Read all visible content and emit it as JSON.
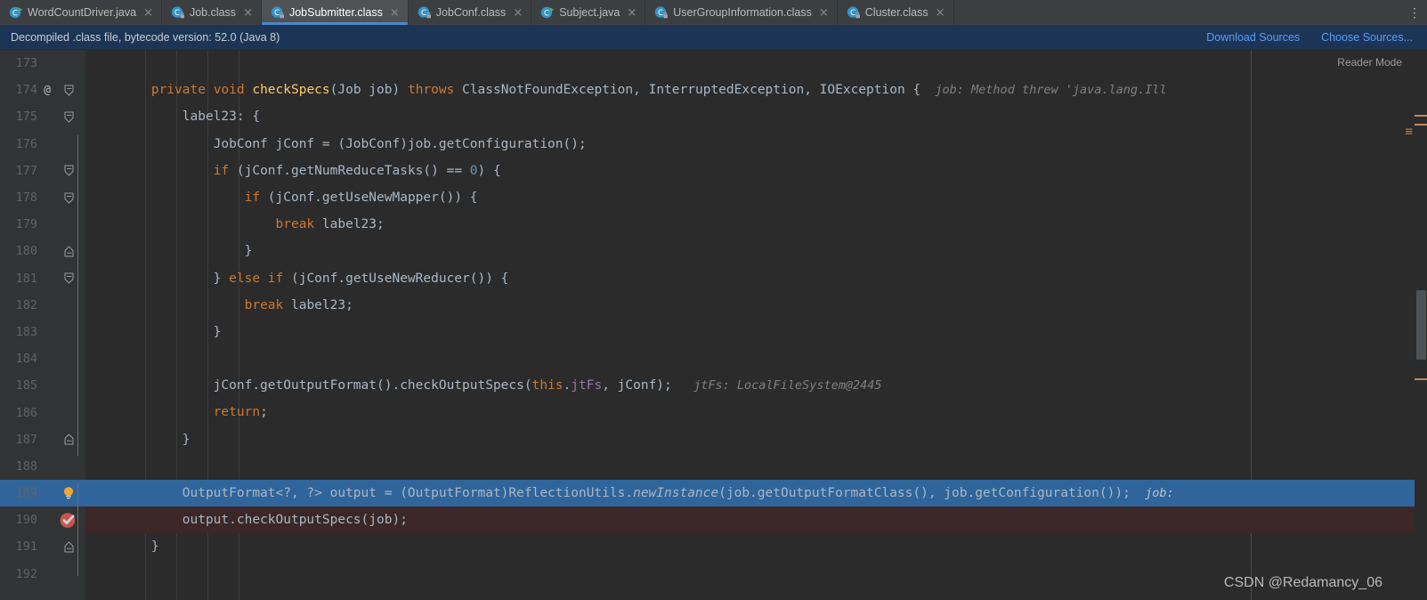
{
  "tabs": [
    {
      "label": "WordCountDriver.java",
      "icon": "java-class-runnable-icon",
      "active": false
    },
    {
      "label": "Job.class",
      "icon": "compiled-class-icon",
      "active": false
    },
    {
      "label": "JobSubmitter.class",
      "icon": "compiled-class-icon",
      "active": true
    },
    {
      "label": "JobConf.class",
      "icon": "compiled-class-icon",
      "active": false
    },
    {
      "label": "Subject.java",
      "icon": "java-class-runnable-icon",
      "active": false
    },
    {
      "label": "UserGroupInformation.class",
      "icon": "compiled-class-icon",
      "active": false
    },
    {
      "label": "Cluster.class",
      "icon": "compiled-class-icon",
      "active": false
    }
  ],
  "tab_close_glyph": "×",
  "tab_overflow_glyph": "⋮",
  "notification": {
    "message": "Decompiled .class file, bytecode version: 52.0 (Java 8)",
    "download_sources": "Download Sources",
    "choose_sources": "Choose Sources..."
  },
  "editor": {
    "reader_mode": "Reader Mode",
    "stripe_equals": "≡",
    "first_line": 173,
    "lines": [
      {
        "n": 173,
        "anno": "",
        "fold": "",
        "state": "normal",
        "gutter_icon": "",
        "html": ""
      },
      {
        "n": 174,
        "anno": "@",
        "fold": "collapse-arrow",
        "state": "normal",
        "gutter_icon": "",
        "html": "        <span class=\"kw\">private</span> <span class=\"kw\">void</span> <span class=\"meth\">checkSpecs</span>(Job job) <span class=\"kw\">throws</span> ClassNotFoundException, InterruptedException, IOException {<span class=\"hint\">  job: Method threw 'java.lang.Ill</span>"
      },
      {
        "n": 175,
        "anno": "",
        "fold": "collapse-arrow",
        "state": "normal",
        "gutter_icon": "",
        "html": "            label23: {"
      },
      {
        "n": 176,
        "anno": "",
        "fold": "",
        "state": "normal",
        "gutter_icon": "",
        "html": "                JobConf jConf = (JobConf)job.getConfiguration();"
      },
      {
        "n": 177,
        "anno": "",
        "fold": "collapse-arrow",
        "state": "normal",
        "gutter_icon": "",
        "html": "                <span class=\"kw\">if</span> (jConf.getNumReduceTasks() == <span class=\"num\">0</span>) {"
      },
      {
        "n": 178,
        "anno": "",
        "fold": "collapse-arrow",
        "state": "normal",
        "gutter_icon": "",
        "html": "                    <span class=\"kw\">if</span> (jConf.getUseNewMapper()) {"
      },
      {
        "n": 179,
        "anno": "",
        "fold": "",
        "state": "normal",
        "gutter_icon": "",
        "html": "                        <span class=\"kw\">break</span> label23;"
      },
      {
        "n": 180,
        "anno": "",
        "fold": "expand-arrow",
        "state": "normal",
        "gutter_icon": "",
        "html": "                    }"
      },
      {
        "n": 181,
        "anno": "",
        "fold": "collapse-arrow",
        "state": "normal",
        "gutter_icon": "",
        "html": "                } <span class=\"kw\">else if</span> (jConf.getUseNewReducer()) {"
      },
      {
        "n": 182,
        "anno": "",
        "fold": "",
        "state": "normal",
        "gutter_icon": "",
        "html": "                    <span class=\"kw\">break</span> label23;"
      },
      {
        "n": 183,
        "anno": "",
        "fold": "",
        "state": "normal",
        "gutter_icon": "",
        "html": "                }"
      },
      {
        "n": 184,
        "anno": "",
        "fold": "",
        "state": "normal",
        "gutter_icon": "",
        "html": ""
      },
      {
        "n": 185,
        "anno": "",
        "fold": "",
        "state": "normal",
        "gutter_icon": "",
        "html": "                jConf.getOutputFormat().checkOutputSpecs(<span class=\"kw\">this</span>.<span class=\"fld\">jtFs</span>, jConf);<span class=\"hint\">   jtFs: LocalFileSystem@2445</span>"
      },
      {
        "n": 186,
        "anno": "",
        "fold": "",
        "state": "normal",
        "gutter_icon": "",
        "html": "                <span class=\"kw\">return</span>;"
      },
      {
        "n": 187,
        "anno": "",
        "fold": "expand-arrow",
        "state": "normal",
        "gutter_icon": "",
        "html": "            }"
      },
      {
        "n": 188,
        "anno": "",
        "fold": "",
        "state": "normal",
        "gutter_icon": "",
        "html": ""
      },
      {
        "n": 189,
        "anno": "",
        "fold": "",
        "state": "selected",
        "gutter_icon": "intention-bulb-icon",
        "html": "            OutputFormat&lt;?, ?&gt; output = (OutputFormat)ReflectionUtils.<span class=\"ital\">newInstance</span>(job.getOutputFormatClass(), job.getConfiguration());<span class=\"hint2\">  job:</span>"
      },
      {
        "n": 190,
        "anno": "",
        "fold": "",
        "state": "breakpoint",
        "gutter_icon": "breakpoint-verified-icon",
        "html": "            output.checkOutputSpecs(job);"
      },
      {
        "n": 191,
        "anno": "",
        "fold": "expand-arrow",
        "state": "normal",
        "gutter_icon": "",
        "html": "        }"
      },
      {
        "n": 192,
        "anno": "",
        "fold": "",
        "state": "normal",
        "gutter_icon": "",
        "html": ""
      }
    ]
  },
  "watermark": "CSDN @Redamancy_06",
  "colors": {
    "accent": "#4a88c7",
    "selection": "#2f659b",
    "breakpoint_row": "#3b2727",
    "breakpoint_dot": "#c75450",
    "keyword": "#cc7832",
    "method": "#ffc66d",
    "number": "#6897bb",
    "field": "#9876aa",
    "notification_bg": "#1c3557",
    "link": "#589df6",
    "warning_stripe": "#bd8a5c"
  }
}
